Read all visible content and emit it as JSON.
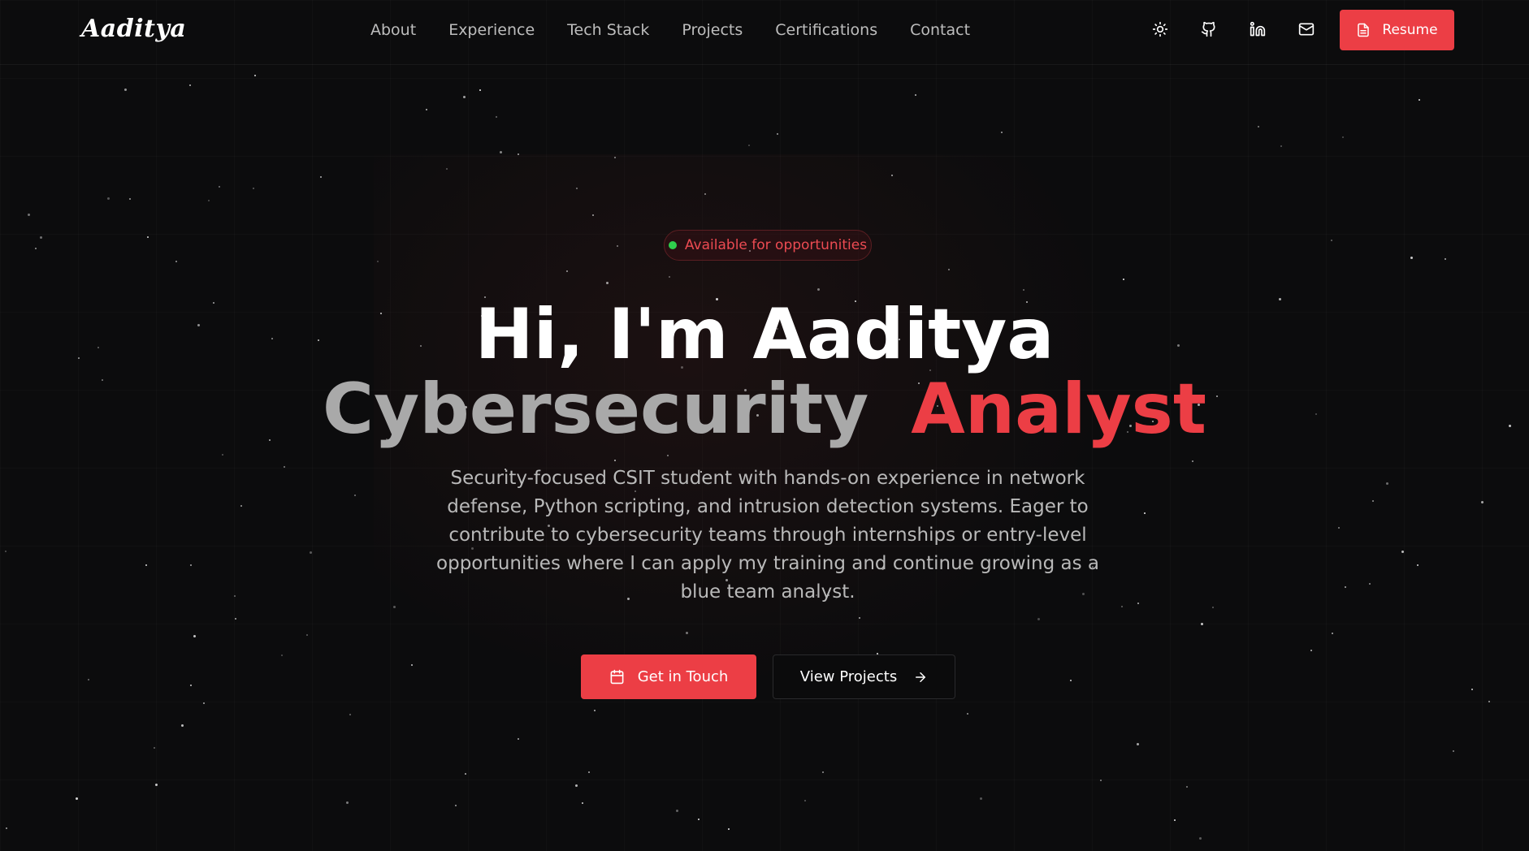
{
  "brand": {
    "logo_text": "Aaditya"
  },
  "nav": {
    "links": [
      {
        "label": "About"
      },
      {
        "label": "Experience"
      },
      {
        "label": "Tech Stack"
      },
      {
        "label": "Projects"
      },
      {
        "label": "Certifications"
      },
      {
        "label": "Contact"
      }
    ],
    "icons": [
      "sun-icon",
      "github-icon",
      "linkedin-icon",
      "mail-icon"
    ],
    "resume_label": "Resume"
  },
  "hero": {
    "badge_text": "Available for opportunities",
    "title": "Hi, I'm Aaditya",
    "role_word": "Cybersecurity",
    "role_accent": "Analyst",
    "description": "Security-focused CSIT student with hands-on experience in network defense, Python scripting, and intrusion detection systems. Eager to contribute to cybersecurity teams through internships or entry-level opportunities where I can apply my training and continue growing as a blue team analyst.",
    "cta_primary_label": "Get in Touch",
    "cta_secondary_label": "View Projects"
  },
  "colors": {
    "accent": "#ec3e45",
    "status_dot": "#2fce4c",
    "background": "#0c0c0d"
  }
}
